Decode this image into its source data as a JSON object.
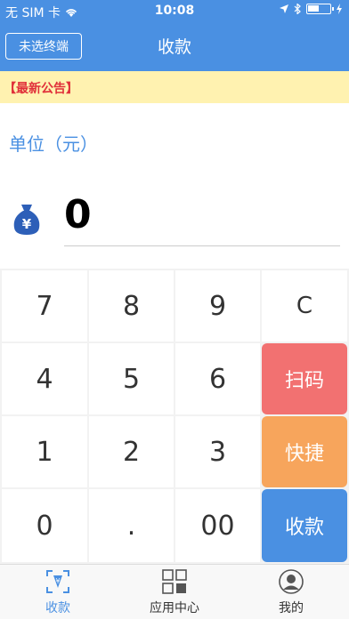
{
  "status": {
    "carrier": "无 SIM 卡",
    "time": "10:08"
  },
  "nav": {
    "title": "收款",
    "terminal_button": "未选终端"
  },
  "notice": {
    "text": "【最新公告】"
  },
  "amount": {
    "unit_label": "单位（元）",
    "value": "0"
  },
  "keypad": {
    "k7": "7",
    "k8": "8",
    "k9": "9",
    "clear": "C",
    "k4": "4",
    "k5": "5",
    "k6": "6",
    "scan": "扫码",
    "k1": "1",
    "k2": "2",
    "k3": "3",
    "quick": "快捷",
    "k0": "0",
    "dot": ".",
    "k00": "00",
    "collect": "收款"
  },
  "tabs": [
    {
      "label": "收款",
      "icon": "collect-tab-icon"
    },
    {
      "label": "应用中心",
      "icon": "apps-grid-icon"
    },
    {
      "label": "我的",
      "icon": "profile-icon"
    }
  ],
  "colors": {
    "brand": "#4a90e2",
    "scan": "#f27171",
    "quick": "#f7a55c",
    "notice_bg": "#fff2b0",
    "notice_text": "#e0303a"
  }
}
